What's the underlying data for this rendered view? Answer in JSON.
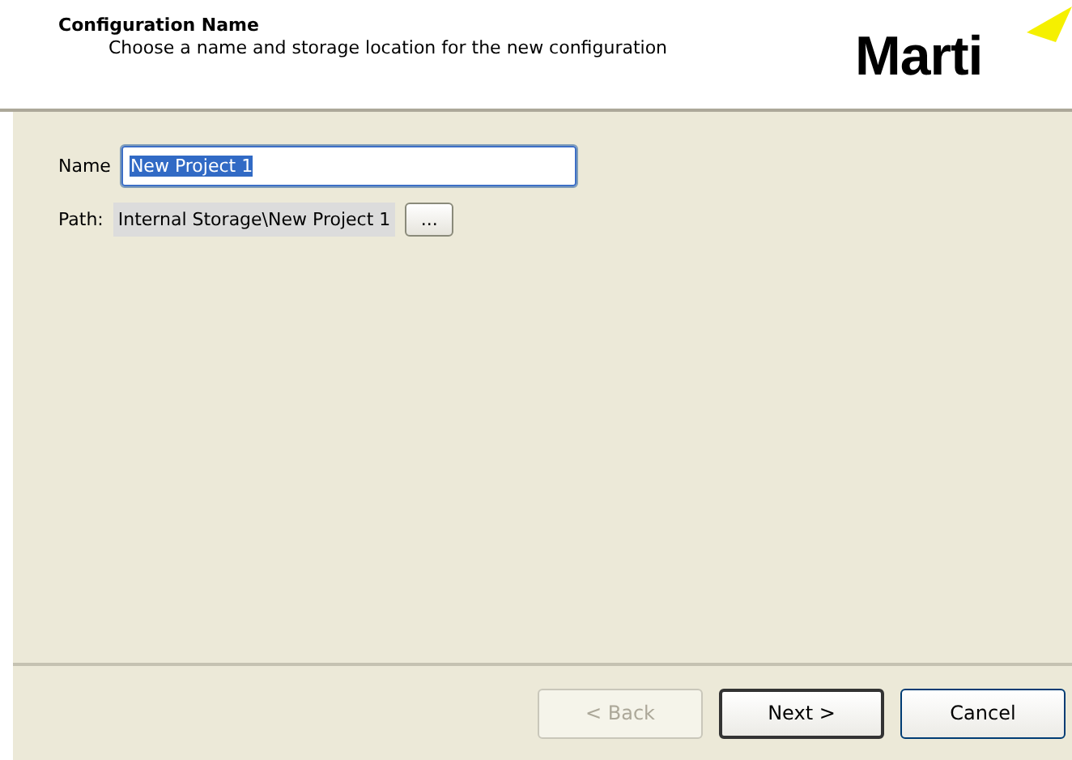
{
  "header": {
    "title": "Configuration Name",
    "subtitle": "Choose a name and storage location for the new configuration",
    "logo": "Marti"
  },
  "form": {
    "name_label": "Name",
    "name_value": "New Project 1",
    "name_value_selected": true,
    "path_label": "Path:",
    "path_value": "Internal Storage\\New Project 1",
    "browse_button": "..."
  },
  "buttons": [
    {
      "label": "< Back",
      "disabled": true,
      "default": false
    },
    {
      "label": "Next >",
      "disabled": false,
      "default": true
    },
    {
      "label": "Cancel",
      "disabled": false,
      "default": false
    }
  ]
}
